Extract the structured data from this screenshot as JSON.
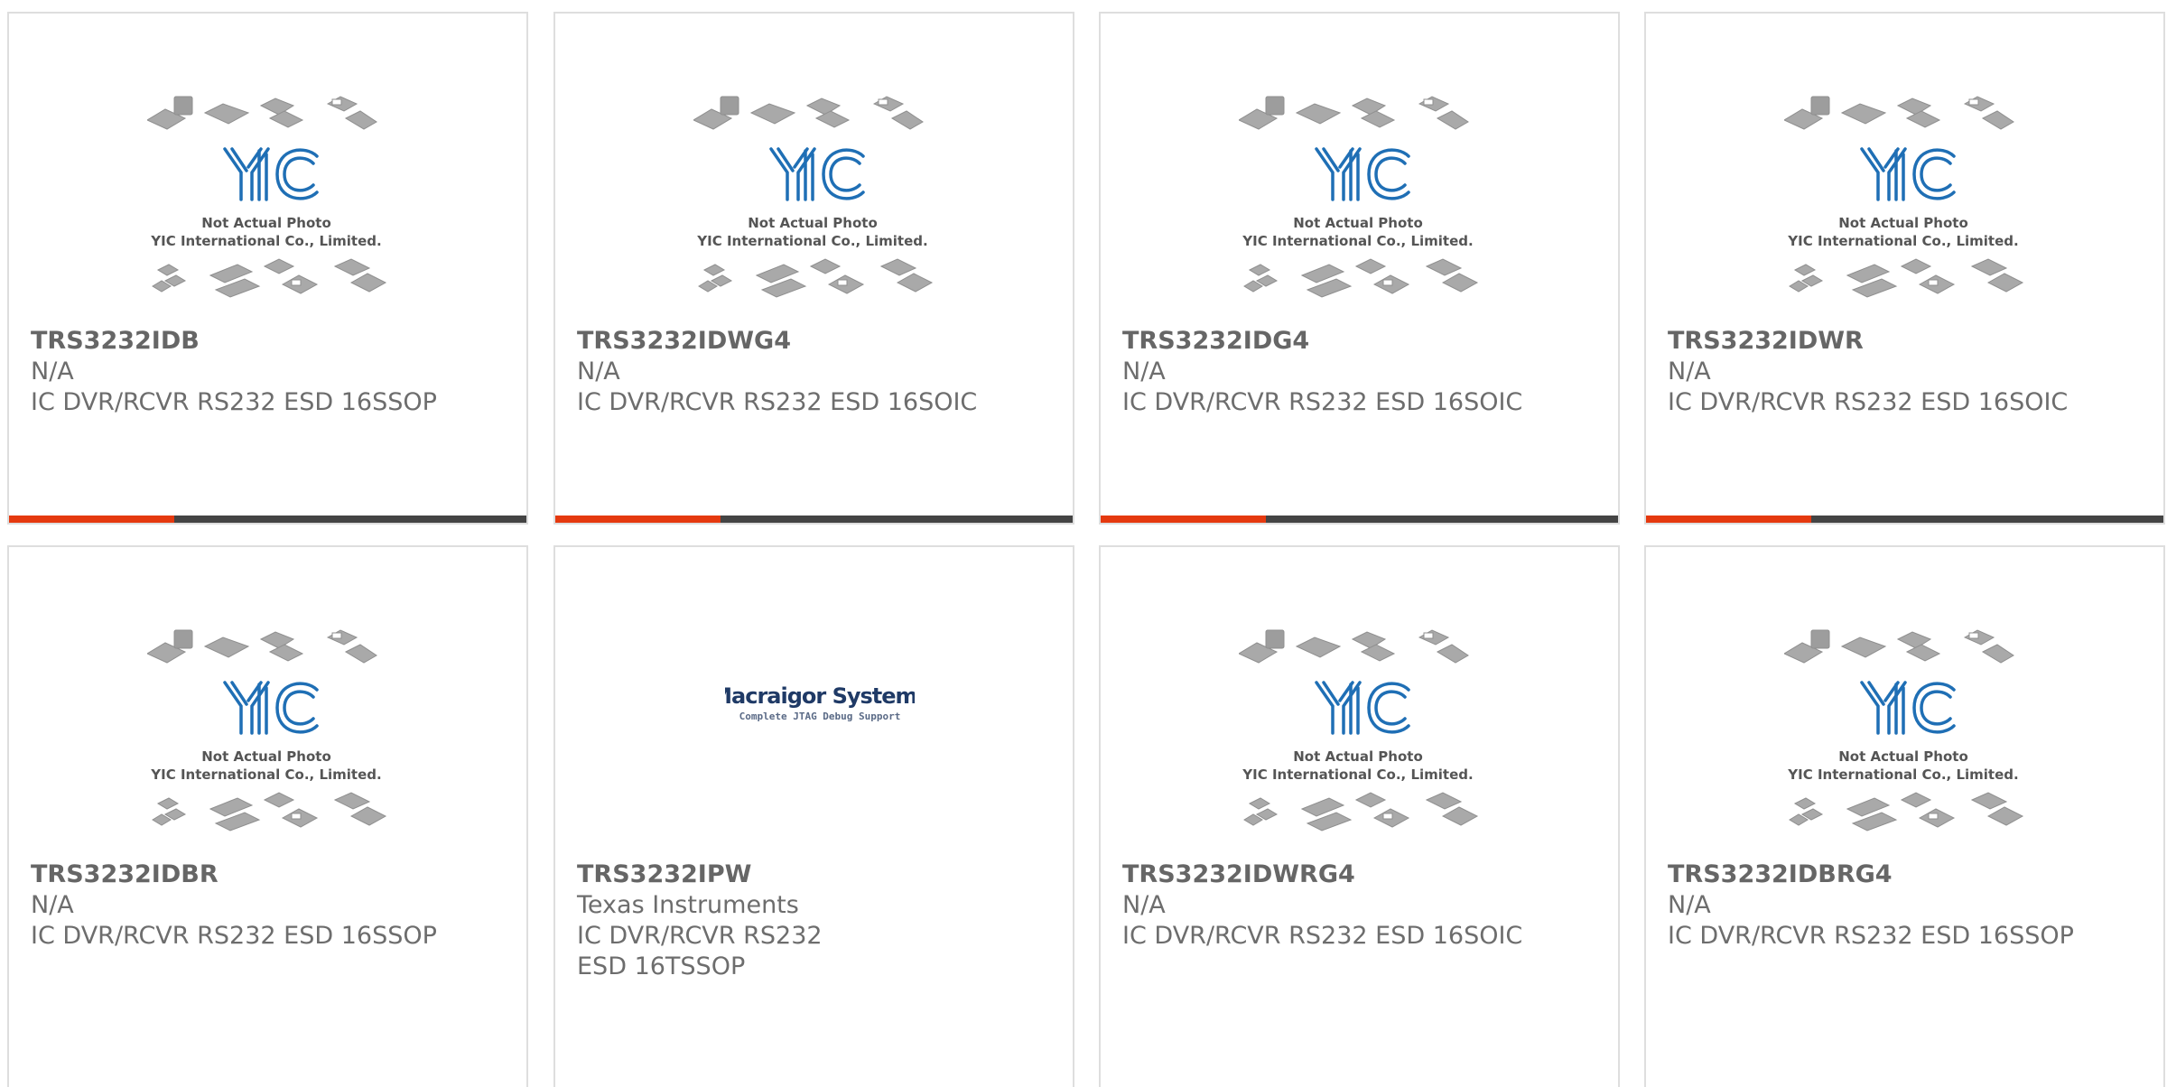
{
  "colors": {
    "accent": "#e5390f",
    "track": "#444444",
    "card_border": "#dedede",
    "yic_blue": "#1f6fb5",
    "chip_gray": "#a9a9a9"
  },
  "placeholder_image": {
    "brand": "YIC",
    "line1": "Not Actual Photo",
    "line2": "YIC International Co., Limited."
  },
  "macraigor_logo": {
    "name": "Macraigor Systems",
    "tagline": "Complete JTAG Debug Support"
  },
  "progress_fraction": 0.32,
  "products": [
    {
      "part": "TRS3232IDB",
      "manufacturer": "N/A",
      "description": "IC DVR/RCVR RS232 ESD 16SSOP",
      "image": "yic-placeholder"
    },
    {
      "part": "TRS3232IDWG4",
      "manufacturer": "N/A",
      "description": "IC DVR/RCVR RS232 ESD 16SOIC",
      "image": "yic-placeholder"
    },
    {
      "part": "TRS3232IDG4",
      "manufacturer": "N/A",
      "description": "IC DVR/RCVR RS232 ESD 16SOIC",
      "image": "yic-placeholder"
    },
    {
      "part": "TRS3232IDWR",
      "manufacturer": "N/A",
      "description": "IC DVR/RCVR RS232 ESD 16SOIC",
      "image": "yic-placeholder"
    },
    {
      "part": "TRS3232IDBR",
      "manufacturer": "N/A",
      "description": "IC DVR/RCVR RS232 ESD 16SSOP",
      "image": "yic-placeholder"
    },
    {
      "part": "TRS3232IPW",
      "manufacturer": "Texas Instruments",
      "description": "IC DVR/RCVR RS232 ESD 16TSSOP",
      "image": "macraigor-logo"
    },
    {
      "part": "TRS3232IDWRG4",
      "manufacturer": "N/A",
      "description": "IC DVR/RCVR RS232 ESD 16SOIC",
      "image": "yic-placeholder"
    },
    {
      "part": "TRS3232IDBRG4",
      "manufacturer": "N/A",
      "description": "IC DVR/RCVR RS232 ESD 16SSOP",
      "image": "yic-placeholder"
    }
  ]
}
